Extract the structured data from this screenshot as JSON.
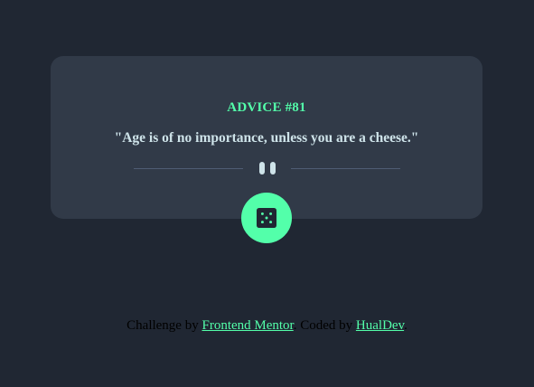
{
  "advice": {
    "id_label": "ADVICE #81",
    "quote": "\"Age is of no importance, unless you are a cheese.\""
  },
  "footer": {
    "challenge_prefix": "Challenge by",
    "challenge_link": "Frontend Mentor",
    "coded_prefix": "Coded by",
    "author_link": "HualDev"
  },
  "icons": {
    "divider": "pause-icon",
    "button": "dice-icon"
  },
  "colors": {
    "background": "#202733",
    "card": "#313a48",
    "accent": "#53ffaa",
    "quote_text": "#cee3e9",
    "divider_line": "#4f5d74"
  }
}
